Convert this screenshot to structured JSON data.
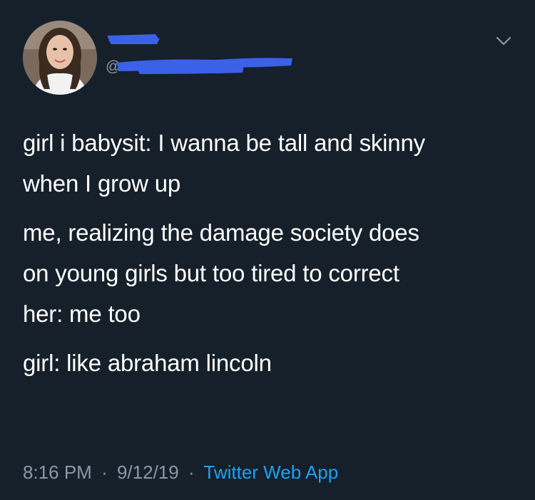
{
  "tweet": {
    "handle_prefix": "@",
    "menu_icon": "chevron-down-icon",
    "paragraphs": [
      "girl i babysit: I wanna be tall and skinny\nwhen I grow up",
      "me, realizing the damage society does\non young girls but too tired to correct\nher: me too",
      "girl: like abraham lincoln"
    ],
    "time": "8:16 PM",
    "separator": "·",
    "date": "9/12/19",
    "source": "Twitter Web App"
  },
  "colors": {
    "background": "#15202b",
    "text": "#ffffff",
    "secondary_text": "#8899a6",
    "link": "#1da1f2",
    "redaction": "#3b61e8"
  }
}
